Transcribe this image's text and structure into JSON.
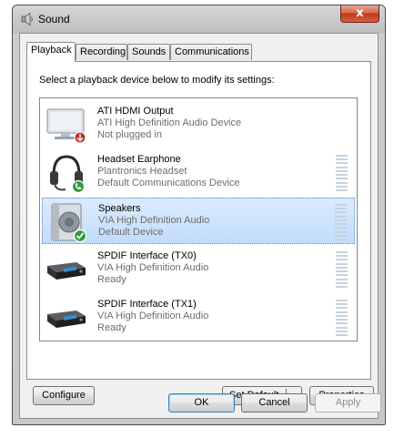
{
  "window": {
    "title": "Sound",
    "close_label": "x"
  },
  "tabs": [
    {
      "label": "Playback",
      "active": true
    },
    {
      "label": "Recording",
      "active": false
    },
    {
      "label": "Sounds",
      "active": false
    },
    {
      "label": "Communications",
      "active": false
    }
  ],
  "instruction": "Select a playback device below to modify its settings:",
  "devices": [
    {
      "name": "ATI HDMI Output",
      "description": "ATI High Definition Audio Device",
      "status": "Not plugged in",
      "icon": "monitor-icon",
      "badge": "red-down-arrow-icon",
      "selected": false
    },
    {
      "name": "Headset Earphone",
      "description": "Plantronics Headset",
      "status": "Default Communications Device",
      "icon": "headset-icon",
      "badge": "green-phone-icon",
      "selected": false
    },
    {
      "name": "Speakers",
      "description": "VIA High Definition Audio",
      "status": "Default Device",
      "icon": "speaker-icon",
      "badge": "green-check-icon",
      "selected": true
    },
    {
      "name": "SPDIF Interface (TX0)",
      "description": "VIA High Definition Audio",
      "status": "Ready",
      "icon": "receiver-icon",
      "badge": null,
      "selected": false
    },
    {
      "name": "SPDIF Interface (TX1)",
      "description": "VIA High Definition Audio",
      "status": "Ready",
      "icon": "receiver-icon",
      "badge": null,
      "selected": false
    }
  ],
  "buttons": {
    "configure": "Configure",
    "set_default": "Set Default",
    "properties": "Properties",
    "ok": "OK",
    "cancel": "Cancel",
    "apply": "Apply"
  },
  "colors": {
    "selection_bg": "#c1dbfc",
    "selection_border": "#5a86c3",
    "close_button": "#c2371c",
    "meter": "#c5d3df"
  }
}
